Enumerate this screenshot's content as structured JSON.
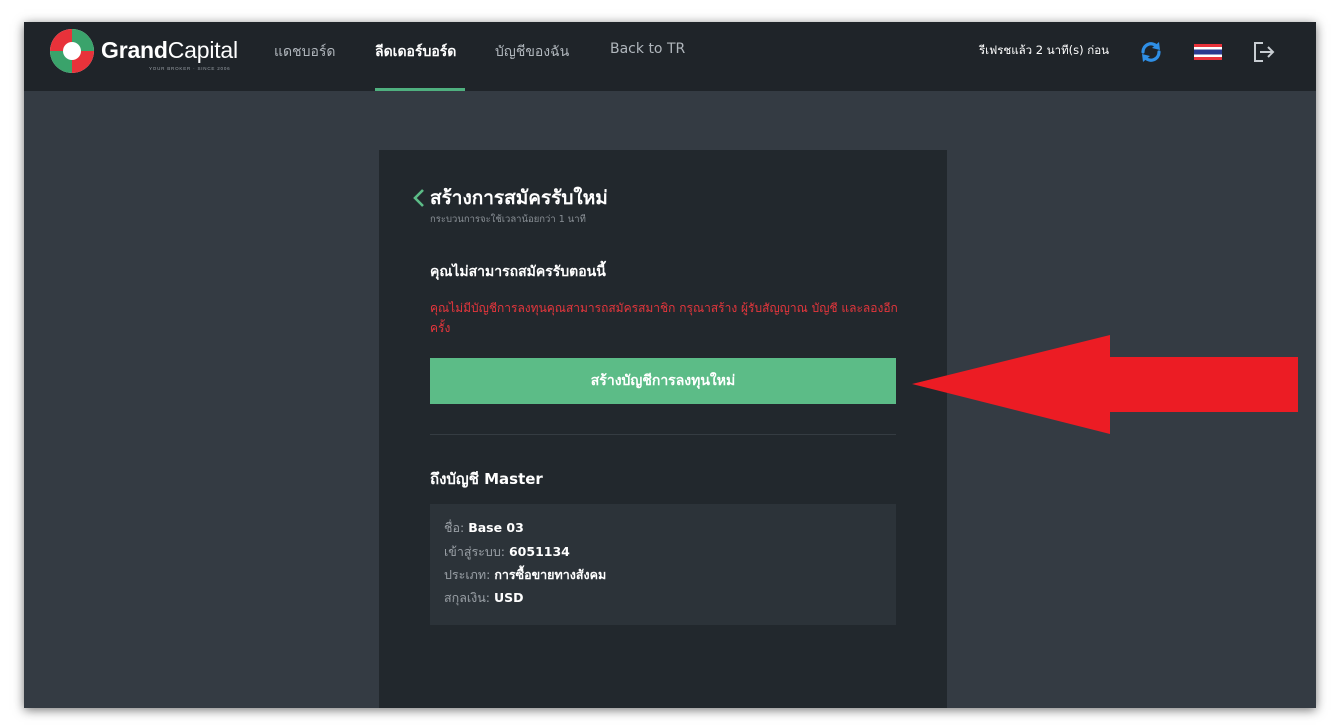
{
  "brand": {
    "name_bold": "Grand",
    "name_light": "Capital",
    "tagline": "YOUR BROKER · SINCE 2006"
  },
  "nav": {
    "items": [
      {
        "label": "แดชบอร์ด"
      },
      {
        "label": "ลีดเดอร์บอร์ด"
      },
      {
        "label": "บัญชีของฉัน"
      },
      {
        "label": "Back to TR"
      }
    ],
    "active": "ลีดเดอร์บอร์ด",
    "refresh_status": "รีเฟรชแล้ว 2 นาที(s) ก่อน",
    "icons": [
      "refresh-icon",
      "thai-flag-icon",
      "logout-icon"
    ]
  },
  "card": {
    "title": "สร้างการสมัครรับใหม่",
    "subtitle": "กระบวนการจะใช้เวลาน้อยกว่า 1 นาที",
    "warning_title": "คุณไม่สามารถสมัครรับตอนนี้",
    "warning_text": "คุณไม่มีบัญชีการลงทุนคุณสามารถสมัครสมาชิก กรุณาสร้าง ผู้รับสัญญาณ บัญชี และลองอีกครั้ง",
    "button_label": "สร้างบัญชีการลงทุนใหม่",
    "master_title": "ถึงบัญชี Master",
    "master_info": {
      "name_label": "ชื่อ:",
      "name_value": "Base 03",
      "login_label": "เข้าสู่ระบบ:",
      "login_value": "6051134",
      "type_label": "ประเภท:",
      "type_value": "การซื้อขายทางสังคม",
      "currency_label": "สกุลเงิน:",
      "currency_value": "USD"
    }
  },
  "colors": {
    "accent_green": "#5cbc87",
    "warning_red": "#e5363c",
    "annotation_arrow": "#ec1c24",
    "navbar_bg": "#1f2429",
    "page_bg": "#343b43",
    "card_bg": "#22282d"
  }
}
